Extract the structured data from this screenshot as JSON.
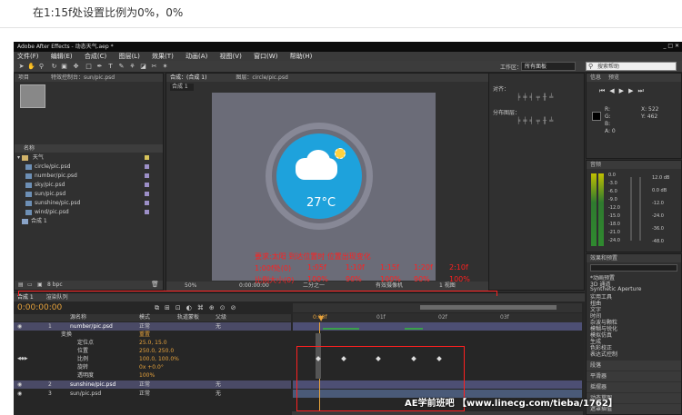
{
  "caption": "在1:15f处设置比例为0%，0%",
  "ae": {
    "title": "Adobe After Effects - 动态天气.aep *",
    "menu": [
      "文件(F)",
      "编辑(E)",
      "合成(C)",
      "图层(L)",
      "效果(T)",
      "动画(A)",
      "视图(V)",
      "窗口(W)",
      "帮助(H)"
    ],
    "workspace_label": "工作区：",
    "workspace_value": "所有面板",
    "search_placeholder": "搜索帮助",
    "project": {
      "tab": "项目",
      "effects_tab": "特效控制台：sun/pic.psd",
      "name_header": "名称",
      "folder": "天气",
      "items": [
        "circle/pic.psd",
        "number/pic.psd",
        "sky/pic.psd",
        "sun/pic.psd",
        "sunshine/pic.psd",
        "wind/pic.psd"
      ],
      "comp": "合成 1",
      "bpc": "8 bpc"
    },
    "viewer": {
      "tab": "合成：(合成 1)",
      "layer_tab": "图层：circle/pic.psd",
      "breadcrumb": "合成 1",
      "temperature": "27°C",
      "zoom": "50%",
      "timecode": "0:00:00:00",
      "quality": "二分之一",
      "camera": "有效摄像机",
      "views": "1 视图"
    },
    "red_note": {
      "line1": "要求:太阳 到达位置时 位置出现变化",
      "line2": [
        "1:00f处(0)",
        "1:05f",
        "1:10f",
        "1:15f",
        "1:20f",
        "2:10f"
      ],
      "line3": [
        "比例大小(0)",
        "100%",
        "90%",
        "100%",
        "90%",
        "100%"
      ]
    },
    "align": {
      "label": "对齐：",
      "distribute": "分布图层："
    },
    "info": {
      "tab": "信息",
      "preview_tab": "预览",
      "x": "X: 522",
      "y": "Y: 462",
      "r": "R:",
      "g": "G:",
      "b": "B:",
      "a": "A: 0"
    },
    "audio": {
      "tab": "音频",
      "levels": [
        "0.0",
        "-3.0",
        "-6.0",
        "-9.0",
        "-12.0",
        "-15.0",
        "-18.0",
        "-21.0",
        "-24.0"
      ],
      "db_labels": [
        "12.0 dB",
        "0.0 dB",
        "-12.0",
        "-24.0",
        "-36.0",
        "-48.0"
      ]
    },
    "effects_presets": {
      "tab": "效果和预置",
      "search": "",
      "items": [
        "*动画预置",
        "3D 通道",
        "Synthetic Aperture",
        "实用工具",
        "扭曲",
        "文字",
        "时间",
        "杂波与颗粒",
        "模糊与锐化",
        "模拟仿真",
        "生成",
        "色彩校正",
        "表达式控制"
      ]
    },
    "side_panels": [
      "段落",
      "平滑器",
      "摇摆器",
      "动态草图",
      "遮罩插值"
    ],
    "timeline": {
      "tab": "合成 1",
      "render_tab": "渲染队列",
      "timecode": "0:00:00:00",
      "headers": {
        "source": "源名称",
        "mode": "模式",
        "trkmat": "轨道蒙板",
        "parent": "父级"
      },
      "layers": [
        {
          "index": "1",
          "name": "number/pic.psd",
          "mode": "正常",
          "parent": "无"
        },
        {
          "index": "2",
          "name": "sunshine/pic.psd",
          "mode": "正常",
          "parent": "无"
        },
        {
          "index": "3",
          "name": "sun/pic.psd",
          "mode": "正常",
          "parent": "无"
        }
      ],
      "transform": "变换",
      "reset": "重置",
      "props": [
        {
          "name": "定位点",
          "value": "25.0, 15.0"
        },
        {
          "name": "位置",
          "value": "250.0, 250.0"
        },
        {
          "name": "比例",
          "value": "100.0, 100.0%"
        },
        {
          "name": "旋转",
          "value": "0x +0.0°"
        },
        {
          "name": "透明度",
          "value": "100%"
        }
      ],
      "ruler": [
        "0:00f",
        "01f",
        "02f",
        "03f"
      ]
    },
    "watermark": "AE学前班吧 【www.linecg.com/tieba/1762】"
  },
  "colors": {
    "accent_red": "#ff2020",
    "orange": "#e6a23c",
    "blue_circle": "#1ea2dc",
    "sun": "#ffd23f"
  }
}
